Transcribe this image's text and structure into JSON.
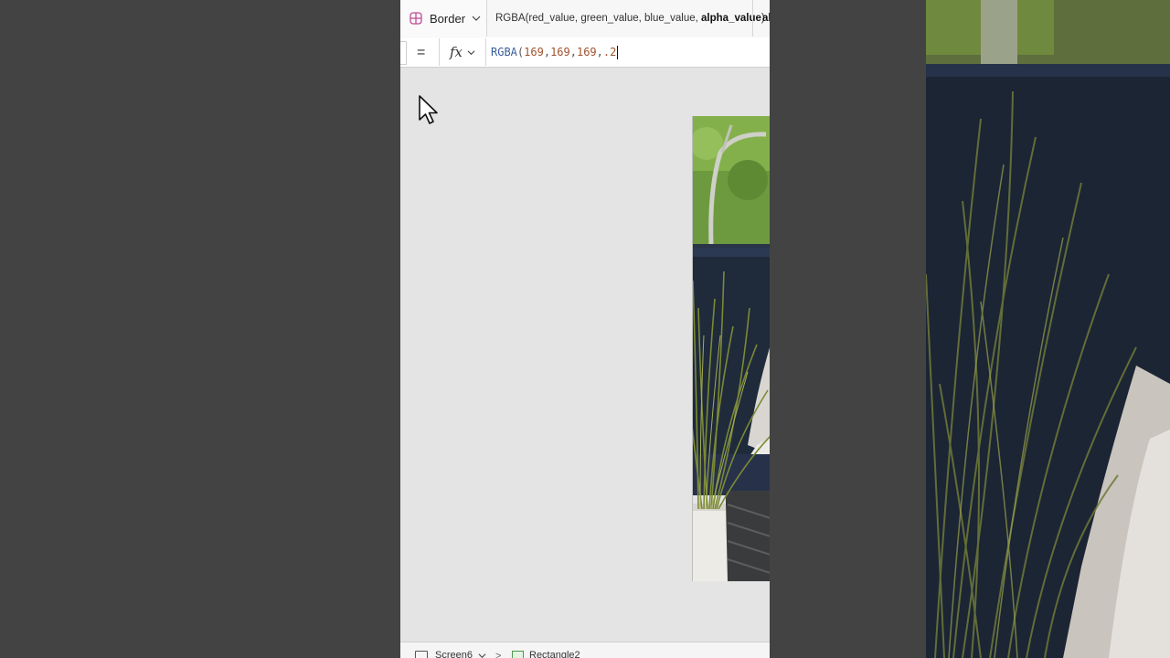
{
  "property_bar": {
    "selected_property": "Border",
    "icon": "property-grid-icon",
    "signature_prefix": "RGBA(red_value, green_value, blue_value, ",
    "signature_active_param": "alpha_value",
    "signature_suffix": ")",
    "next_hint": "al"
  },
  "formula_bar": {
    "equals": "=",
    "fx_label": "fx",
    "tokens": {
      "fn": "RGBA",
      "open": "(",
      "r": "169",
      "c1": ",",
      "g": "169",
      "c2": ",",
      "b": "169",
      "c3": ",",
      "a": ".2"
    }
  },
  "bottom_bar": {
    "screen_name": "Screen6",
    "separator": ">",
    "control_name": "Rectangle2"
  },
  "colors": {
    "backdrop": "#434343",
    "canvas": "#e4e4e4",
    "token_function": "#3a5d9c",
    "token_number": "#a0522d",
    "property_icon": "#c04a9a"
  }
}
